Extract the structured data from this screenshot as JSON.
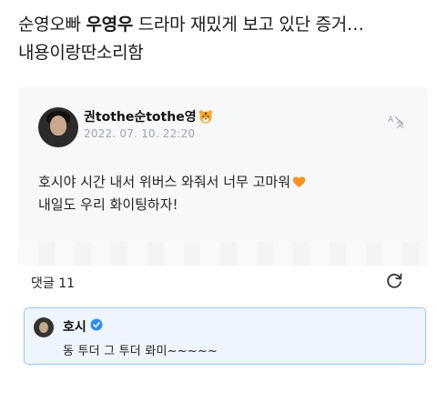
{
  "headline": {
    "prefix": "순영오빠 ",
    "bold": "우영우",
    "suffix": " 드라마 재밌게 보고 있단 증거…",
    "line2": "내용이랑딴소리함"
  },
  "post": {
    "author": "권tothe순tothe영",
    "author_emoji": "tiger-face-icon",
    "date": "2022. 07. 10. 22:20",
    "translate_icon": "translate-icon",
    "line1": "호시야 시간 내서 위버스 와줘서 너무 고마워",
    "line1_emoji": "orange-heart-icon",
    "line2": "내일도 우리 화이팅하자!"
  },
  "comments": {
    "label": "댓글 11",
    "refresh_icon": "refresh-icon"
  },
  "comment": {
    "author": "호시",
    "verified_icon": "verified-badge-icon",
    "text": "동 투더 그 투더 롸미~~~~~"
  },
  "colors": {
    "card_bg": "#f7f8fa",
    "highlight_bg": "#eef5ff",
    "highlight_border": "#9cc3f2",
    "verified": "#2f8cf0",
    "heart": "#f7931e",
    "date": "#a0a5ad"
  }
}
